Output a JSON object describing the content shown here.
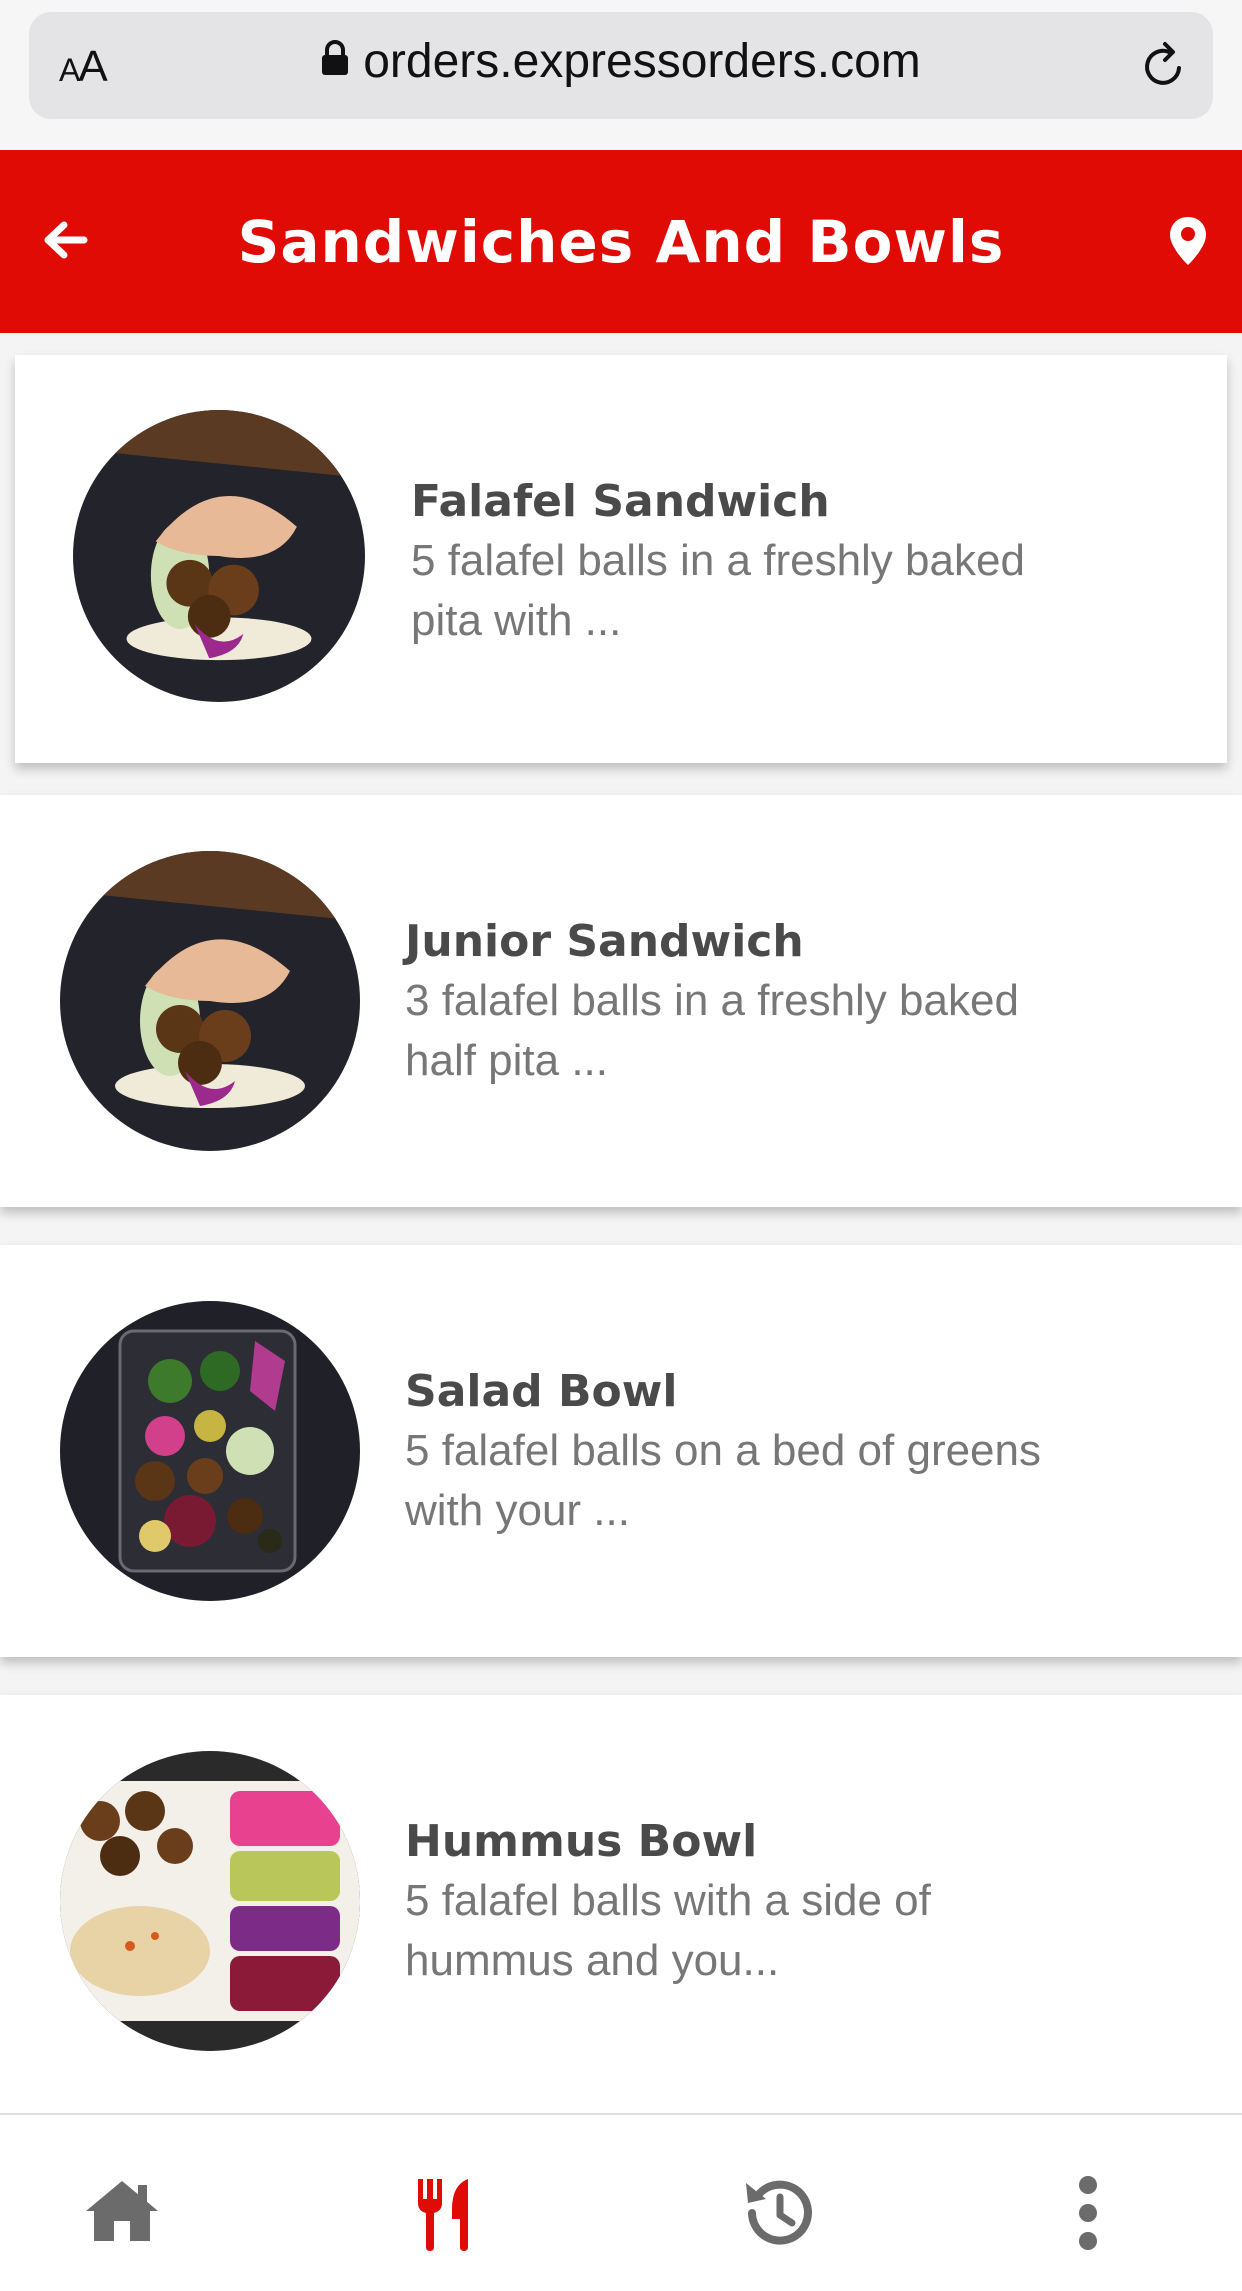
{
  "browser": {
    "text_size_label_small": "A",
    "text_size_label_large": "A",
    "url": "orders.expressorders.com"
  },
  "header": {
    "title": "Sandwiches And Bowls"
  },
  "items": [
    {
      "name": "Falafel Sandwich",
      "description_line1": "5 falafel balls in a freshly baked",
      "description_line2": "pita with ..."
    },
    {
      "name": "Junior Sandwich",
      "description_line1": "3 falafel balls in a freshly baked",
      "description_line2": "half pita ..."
    },
    {
      "name": "Salad Bowl",
      "description_line1": "5 falafel balls on a bed of greens",
      "description_line2": "with your ..."
    },
    {
      "name": "Hummus Bowl",
      "description_line1": "5 falafel balls with a side of",
      "description_line2": "hummus and you..."
    }
  ],
  "nav": {
    "active": "menu",
    "icons": [
      "home-icon",
      "utensils-icon",
      "history-icon",
      "more-vertical-icon"
    ]
  },
  "colors": {
    "brand_red": "#e00b04",
    "nav_inactive": "#6b6b6b"
  }
}
